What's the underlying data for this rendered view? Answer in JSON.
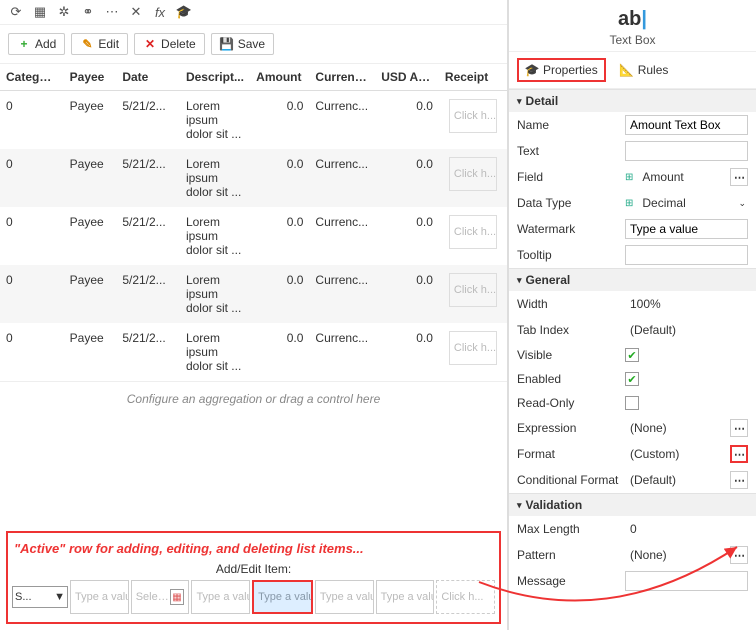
{
  "toolbar": {
    "add": "Add",
    "edit": "Edit",
    "delete": "Delete",
    "save": "Save"
  },
  "columns": [
    "Category",
    "Payee",
    "Date",
    "Descript...",
    "Amount",
    "Currenc...",
    "USD Am...",
    "Receipt"
  ],
  "rows": [
    {
      "cat": "0",
      "payee": "Payee",
      "date": "5/21/2...",
      "desc": "Lorem ipsum dolor sit ...",
      "amount": "0.0",
      "curr": "Currenc...",
      "usd": "0.0",
      "receipt": "Click h..."
    },
    {
      "cat": "0",
      "payee": "Payee",
      "date": "5/21/2...",
      "desc": "Lorem ipsum dolor sit ...",
      "amount": "0.0",
      "curr": "Currenc...",
      "usd": "0.0",
      "receipt": "Click h..."
    },
    {
      "cat": "0",
      "payee": "Payee",
      "date": "5/21/2...",
      "desc": "Lorem ipsum dolor sit ...",
      "amount": "0.0",
      "curr": "Currenc...",
      "usd": "0.0",
      "receipt": "Click h..."
    },
    {
      "cat": "0",
      "payee": "Payee",
      "date": "5/21/2...",
      "desc": "Lorem ipsum dolor sit ...",
      "amount": "0.0",
      "curr": "Currenc...",
      "usd": "0.0",
      "receipt": "Click h..."
    },
    {
      "cat": "0",
      "payee": "Payee",
      "date": "5/21/2...",
      "desc": "Lorem ipsum dolor sit ...",
      "amount": "0.0",
      "curr": "Currenc...",
      "usd": "0.0",
      "receipt": "Click h..."
    }
  ],
  "agg_hint": "Configure an aggregation or drag a control here",
  "active": {
    "title": "\"Active\" row for adding, editing, and deleting list items...",
    "sub": "Add/Edit Item:",
    "drop": "S...",
    "placeholder": "Type a value",
    "select": "Selec...",
    "receipt_ph": "Click h..."
  },
  "side": {
    "icon": "ab",
    "title": "Text Box",
    "tabs": {
      "props": "Properties",
      "rules": "Rules"
    }
  },
  "sections": {
    "detail": "Detail",
    "general": "General",
    "validation": "Validation"
  },
  "props": {
    "name_lbl": "Name",
    "name": "Amount Text Box",
    "text_lbl": "Text",
    "text": "",
    "field_lbl": "Field",
    "field": "Amount",
    "dtype_lbl": "Data Type",
    "dtype": "Decimal",
    "wm_lbl": "Watermark",
    "wm": "Type a value",
    "tip_lbl": "Tooltip",
    "tip": "",
    "width_lbl": "Width",
    "width": "100%",
    "tab_lbl": "Tab Index",
    "tab": "(Default)",
    "vis_lbl": "Visible",
    "vis": true,
    "en_lbl": "Enabled",
    "en": true,
    "ro_lbl": "Read-Only",
    "ro": false,
    "expr_lbl": "Expression",
    "expr": "(None)",
    "fmt_lbl": "Format",
    "fmt": "(Custom)",
    "cfmt_lbl": "Conditional Format",
    "cfmt": "(Default)",
    "maxl_lbl": "Max Length",
    "maxl": "0",
    "pat_lbl": "Pattern",
    "pat": "(None)",
    "msg_lbl": "Message",
    "msg": ""
  }
}
